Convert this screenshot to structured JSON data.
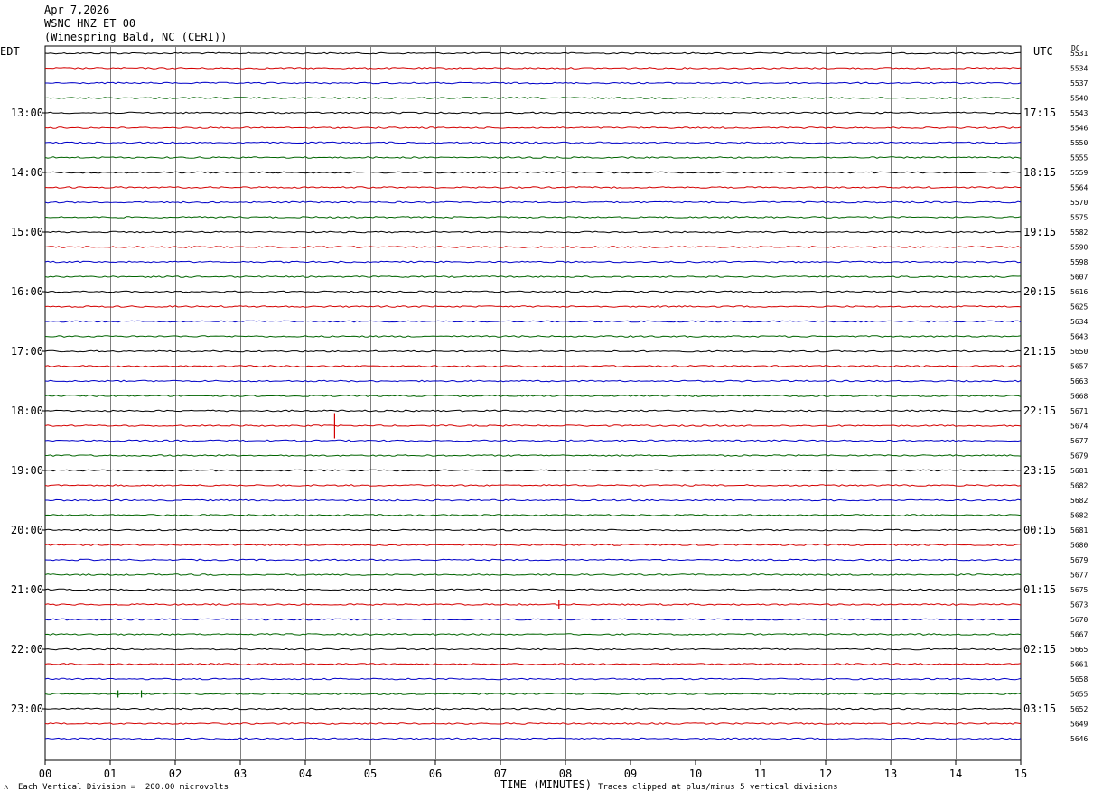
{
  "header": {
    "date": "Apr 7,2026",
    "channel": "WSNC HNZ ET 00",
    "station": "(Winespring Bald, NC (CERI))"
  },
  "left_timezone": "EDT",
  "right_timezone": "UTC",
  "dc_label": "DC",
  "footer": {
    "scale_note": "Each Vertical Division =  200.00 microvolts",
    "clip_note": "Traces clipped at plus/minus 5 vertical divisions",
    "xlabel": "TIME (MINUTES)"
  },
  "chart_data": {
    "type": "line",
    "title": "WSNC HNZ ET 00",
    "xlabel": "TIME (MINUTES)",
    "xlim": [
      0,
      15
    ],
    "x_ticks": [
      "00",
      "01",
      "02",
      "03",
      "04",
      "05",
      "06",
      "07",
      "08",
      "09",
      "10",
      "11",
      "12",
      "13",
      "14",
      "15"
    ],
    "trace_colors": [
      "#000000",
      "#d40000",
      "#0000c8",
      "#006400"
    ],
    "left_hour_labels": [
      "13:00",
      "14:00",
      "15:00",
      "16:00",
      "17:00",
      "18:00",
      "19:00",
      "20:00",
      "21:00",
      "22:00",
      "23:00"
    ],
    "right_hour_labels": [
      "17:15",
      "18:15",
      "19:15",
      "20:15",
      "21:15",
      "22:15",
      "23:15",
      "00:15",
      "01:15",
      "02:15",
      "03:15"
    ],
    "dc_values": [
      "5531",
      "5534",
      "5537",
      "5540",
      "5543",
      "5546",
      "5550",
      "5555",
      "5559",
      "5564",
      "5570",
      "5575",
      "5582",
      "5590",
      "5598",
      "5607",
      "5616",
      "5625",
      "5634",
      "5643",
      "5650",
      "5657",
      "5663",
      "5668",
      "5671",
      "5674",
      "5677",
      "5679",
      "5681",
      "5682",
      "5682",
      "5682",
      "5681",
      "5680",
      "5679",
      "5677",
      "5675",
      "5673",
      "5670",
      "5667",
      "5665",
      "5661",
      "5658",
      "5655",
      "5652",
      "5649",
      "5646"
    ],
    "events": [
      {
        "trace": 25,
        "minute": 4.45,
        "amplitude": "large"
      },
      {
        "trace": 37,
        "minute": 7.9,
        "amplitude": "medium"
      },
      {
        "trace": 43,
        "minute": 1.12,
        "amplitude": "small"
      },
      {
        "trace": 43,
        "minute": 1.48,
        "amplitude": "small"
      }
    ]
  }
}
